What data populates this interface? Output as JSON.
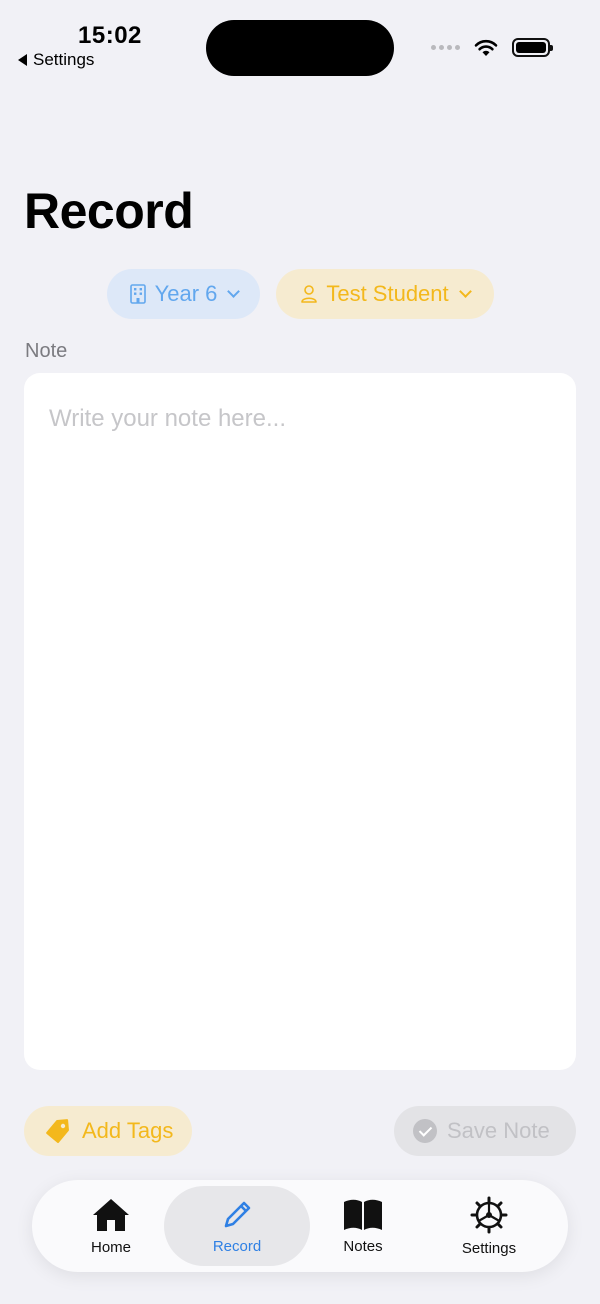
{
  "status_bar": {
    "time": "15:02",
    "back_label": "Settings",
    "icons": [
      "back-arrow-icon",
      "signal-icon",
      "wifi-icon",
      "battery-icon"
    ]
  },
  "page": {
    "title": "Record"
  },
  "filters": {
    "class_selector": {
      "label": "Year 6",
      "icon": "building-icon",
      "color": "#62a7ee"
    },
    "student_selector": {
      "label": "Test Student",
      "icon": "person-icon",
      "color": "#f3b81c"
    }
  },
  "note": {
    "label": "Note",
    "value": "",
    "placeholder": "Write your note here..."
  },
  "actions": {
    "add_tags_label": "Add Tags",
    "add_tags_icon": "tag-icon",
    "save_label": "Save Note",
    "save_icon": "checkmark-circle-icon"
  },
  "tab_bar": {
    "items": [
      {
        "label": "Home",
        "icon": "house-icon",
        "selected": false
      },
      {
        "label": "Record",
        "icon": "pencil-icon",
        "selected": true
      },
      {
        "label": "Notes",
        "icon": "book-icon",
        "selected": false
      },
      {
        "label": "Settings",
        "icon": "gear-icon",
        "selected": false
      }
    ],
    "accent_color": "#2f80e4"
  }
}
